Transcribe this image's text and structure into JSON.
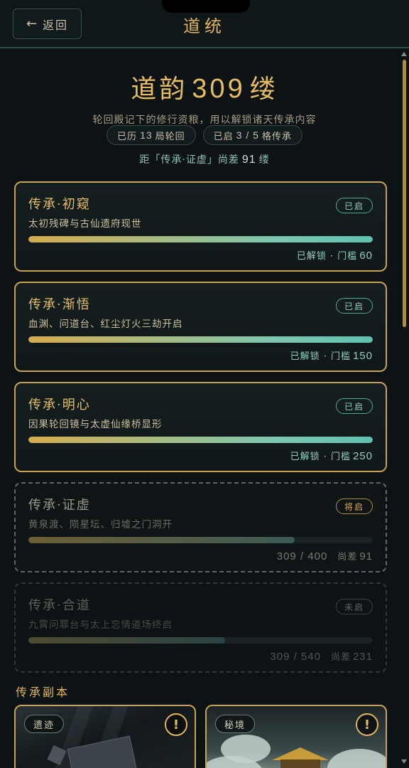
{
  "header": {
    "back_label": "返回",
    "title": "道统"
  },
  "summary": {
    "score_label": "道韵",
    "score_value": "309",
    "score_unit": "缕",
    "subtitle": "轮回殿记下的修行资粮，用以解锁诸天传承内容",
    "pill_cycles_prefix": "已历",
    "pill_cycles_value": "13",
    "pill_cycles_suffix": "局轮回",
    "pill_open_prefix": "已启",
    "pill_open_value": "3 / 5",
    "pill_open_suffix": "格传承",
    "distance_prefix": "距「传承·证虚」尚差",
    "distance_value": "91",
    "distance_suffix": "缕"
  },
  "cards": [
    {
      "title": "传承·初窥",
      "desc": "太初残碑与古仙遗府现世",
      "badge": "已启",
      "status_prefix": "已解锁 · 门槛",
      "status_value": "60",
      "progress": 1.0
    },
    {
      "title": "传承·渐悟",
      "desc": "血渊、问道台、红尘灯火三劫开启",
      "badge": "已启",
      "status_prefix": "已解锁 · 门槛",
      "status_value": "150",
      "progress": 1.0
    },
    {
      "title": "传承·明心",
      "desc": "因果轮回镜与太虚仙缘桥显形",
      "badge": "已启",
      "status_prefix": "已解锁 · 门槛",
      "status_value": "250",
      "progress": 1.0
    },
    {
      "title": "传承·证虚",
      "desc": "黄泉渡、陨星坛、归墟之门洞开",
      "badge": "将启",
      "status_progress": "309 / 400",
      "status_remaining_label": "尚差",
      "status_remaining": "91",
      "progress": 0.7725
    },
    {
      "title": "传承·合道",
      "desc": "九霄问罪台与太上忘情道场终启",
      "badge": "未启",
      "status_progress": "309 / 540",
      "status_remaining_label": "尚差",
      "status_remaining": "231",
      "progress": 0.572
    }
  ],
  "instances_section": {
    "title": "传承副本",
    "items": [
      {
        "tag": "遗迹",
        "alert": "!"
      },
      {
        "tag": "秘境",
        "alert": "!"
      }
    ]
  },
  "colors": {
    "accent_gold": "#e2b657",
    "accent_teal": "#8fd0c1",
    "background": "#0d1214"
  }
}
